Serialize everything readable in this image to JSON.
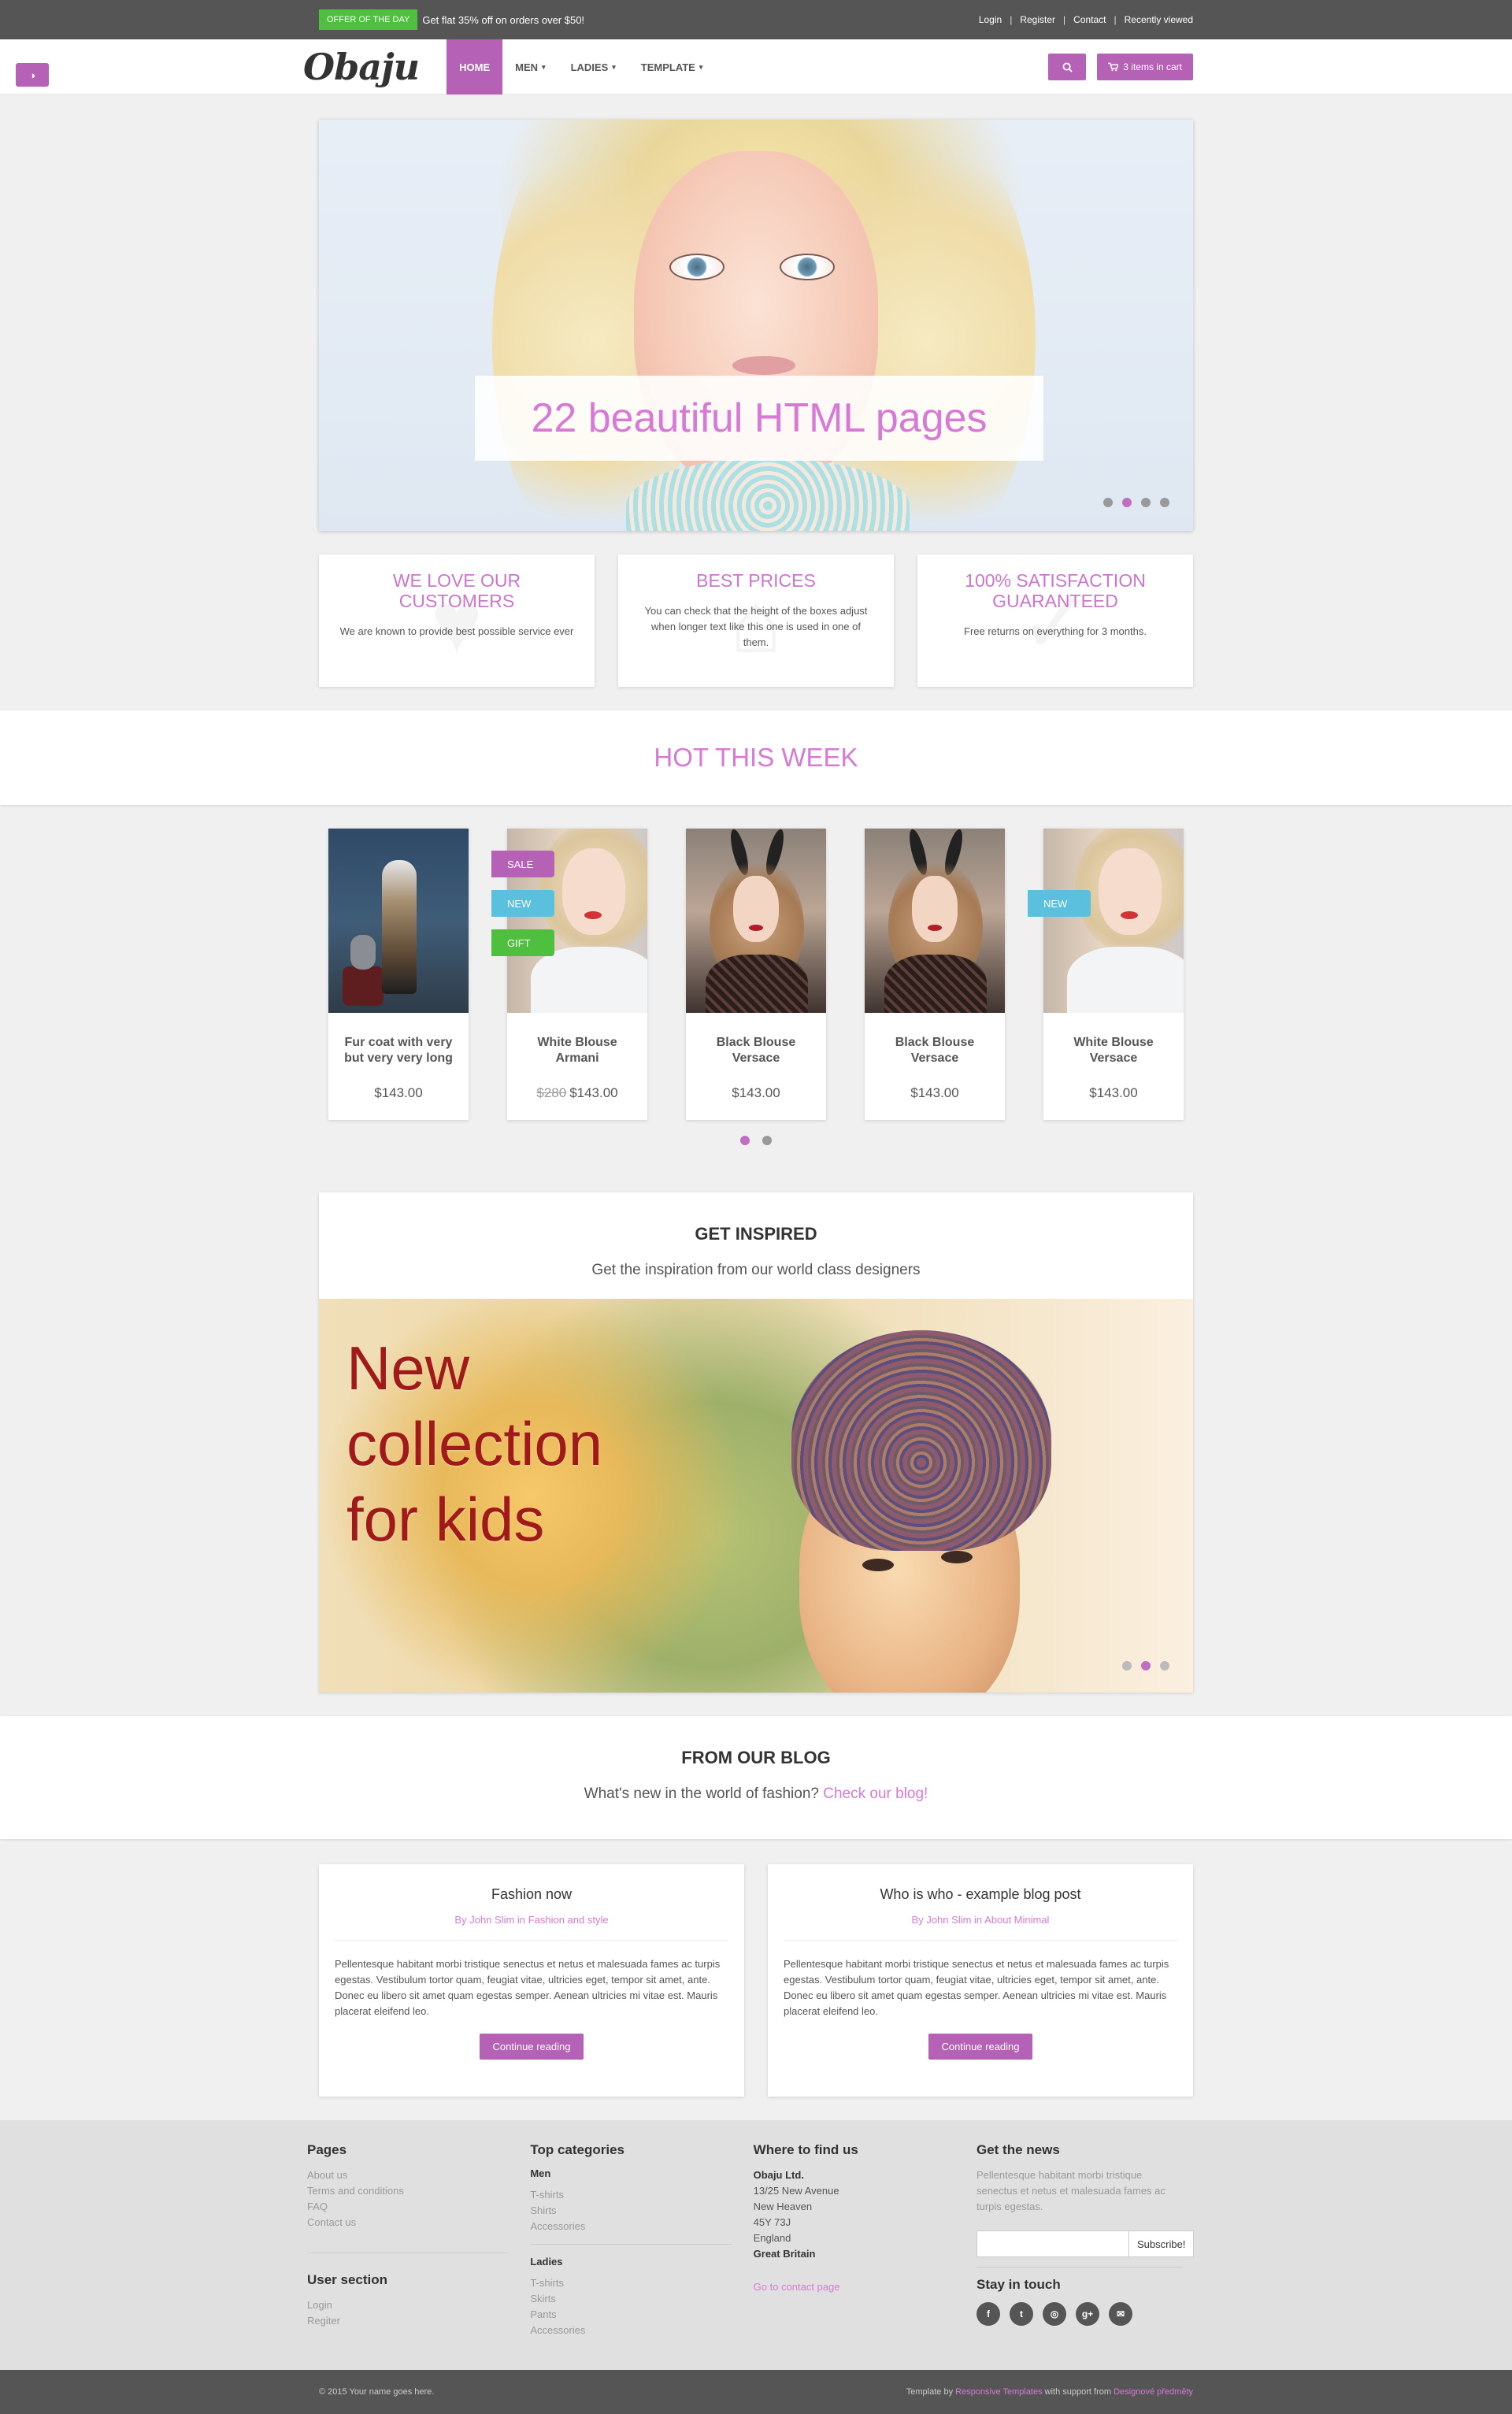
{
  "topbar": {
    "offer_badge": "OFFER OF THE DAY",
    "offer_text": "Get flat 35% off on orders over $50!",
    "links": [
      "Login",
      "Register",
      "Contact",
      "Recently viewed"
    ],
    "separator": "|"
  },
  "navbar": {
    "logo": "Obaju",
    "menu": [
      {
        "label": "HOME",
        "active": true
      },
      {
        "label": "MEN"
      },
      {
        "label": "LADIES"
      },
      {
        "label": "TEMPLATE"
      }
    ],
    "caret": "▾",
    "cart_label": "3 items in cart",
    "style_switch_icon": "◑"
  },
  "slider": {
    "caption": "22 beautiful HTML pages",
    "active_dot": 1
  },
  "advantages": [
    {
      "title": "WE LOVE OUR CUSTOMERS",
      "text": "We are known to provide best possible service ever",
      "icon": "heart-icon"
    },
    {
      "title": "BEST PRICES",
      "text": "You can check that the height of the boxes adjust when longer text like this one is used in one of them.",
      "icon": "tag-icon"
    },
    {
      "title": "100% SATISFACTION GUARANTEED",
      "text": "Free returns on everything for 3 months.",
      "icon": "thumbs-up-icon"
    }
  ],
  "hot": {
    "title": "HOT THIS WEEK",
    "products": [
      {
        "name": "Fur coat with very but very very long",
        "price": "$143.00",
        "old_price": "",
        "image": "coat"
      },
      {
        "name": "White Blouse Armani",
        "price": "$143.00",
        "old_price": "$280",
        "image": "white",
        "ribbons": [
          "SALE",
          "NEW",
          "GIFT"
        ]
      },
      {
        "name": "Black Blouse Versace",
        "price": "$143.00",
        "old_price": "",
        "image": "black"
      },
      {
        "name": "Black Blouse Versace",
        "price": "$143.00",
        "old_price": "",
        "image": "black"
      },
      {
        "name": "White Blouse Versace",
        "price": "$143.00",
        "old_price": "",
        "image": "white",
        "ribbons": [
          "NEW"
        ]
      }
    ]
  },
  "inspire": {
    "title": "GET INSPIRED",
    "subtitle": "Get the inspiration from our world class designers",
    "banner_text": "New collection for kids"
  },
  "blog": {
    "title": "FROM OUR BLOG",
    "subtitle": "What's new in the world of fashion?",
    "link": "Check our blog!",
    "posts": [
      {
        "title": "Fashion now",
        "by": "By",
        "author": "John Slim",
        "in": "in",
        "category": "Fashion and style",
        "text": "Pellentesque habitant morbi tristique senectus et netus et malesuada fames ac turpis egestas. Vestibulum tortor quam, feugiat vitae, ultricies eget, tempor sit amet, ante. Donec eu libero sit amet quam egestas semper. Aenean ultricies mi vitae est. Mauris placerat eleifend leo.",
        "button": "Continue reading"
      },
      {
        "title": "Who is who - example blog post",
        "by": "By",
        "author": "John Slim",
        "in": "in",
        "category": "About Minimal",
        "text": "Pellentesque habitant morbi tristique senectus et netus et malesuada fames ac turpis egestas. Vestibulum tortor quam, feugiat vitae, ultricies eget, tempor sit amet, ante. Donec eu libero sit amet quam egestas semper. Aenean ultricies mi vitae est. Mauris placerat eleifend leo.",
        "button": "Continue reading"
      }
    ]
  },
  "footer": {
    "pages": {
      "title": "Pages",
      "links": [
        "About us",
        "Terms and conditions",
        "FAQ",
        "Contact us"
      ]
    },
    "user": {
      "title": "User section",
      "links": [
        "Login",
        "Regiter"
      ]
    },
    "categories": {
      "title": "Top categories",
      "men": {
        "title": "Men",
        "links": [
          "T-shirts",
          "Shirts",
          "Accessories"
        ]
      },
      "ladies": {
        "title": "Ladies",
        "links": [
          "T-shirts",
          "Skirts",
          "Pants",
          "Accessories"
        ]
      }
    },
    "find": {
      "title": "Where to find us",
      "company": "Obaju Ltd.",
      "lines": [
        "13/25 New Avenue",
        "New Heaven",
        "45Y 73J",
        "England"
      ],
      "country": "Great Britain",
      "contact_link": "Go to contact page"
    },
    "news": {
      "title": "Get the news",
      "text": "Pellentesque habitant morbi tristique senectus et netus et malesuada fames ac turpis egestas.",
      "input_placeholder": "",
      "button": "Subscribe!",
      "stay_title": "Stay in touch",
      "socials": [
        "f",
        "t",
        "◎",
        "g+",
        "✉"
      ],
      "social_icons": [
        "facebook-icon",
        "twitter-icon",
        "instagram-icon",
        "google-plus-icon",
        "email-icon"
      ]
    }
  },
  "copyright": {
    "left": "© 2015 Your name goes here.",
    "right_prefix": "Template by",
    "right_link1": "Responsive Templates",
    "right_mid": "with support from",
    "right_link2": "Designové předměty"
  },
  "colors": {
    "accent": "#b561b5",
    "accent_light": "#d67ad6",
    "offer": "#4fbf40",
    "new": "#5bc0de",
    "dark": "#555555"
  }
}
